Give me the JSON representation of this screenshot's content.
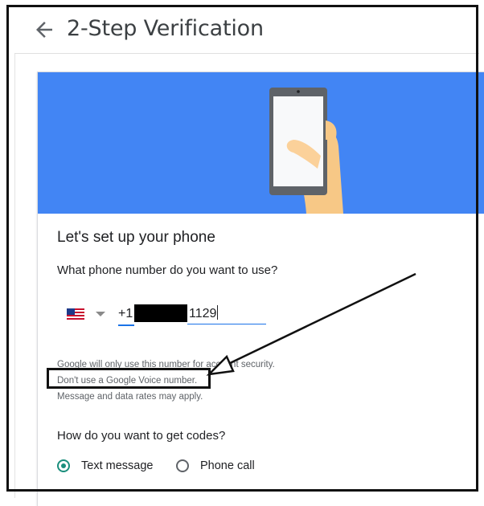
{
  "header": {
    "title": "2-Step Verification"
  },
  "card": {
    "heading": "Let's set up your phone",
    "phone_question": "What phone number do you want to use?",
    "country_code": "+1",
    "phone_visible_digits": "1129",
    "notes": [
      "Google will only use this number for account security.",
      "Don't use a Google Voice number.",
      "Message and data rates may apply."
    ],
    "codes_question": "How do you want to get codes?",
    "options": [
      {
        "label": "Text message",
        "selected": true
      },
      {
        "label": "Phone call",
        "selected": false
      }
    ]
  },
  "colors": {
    "hero": "#4285f4",
    "accent": "#1a73e8",
    "radio_selected": "#1a8e7c"
  },
  "icons": {
    "back": "arrow-left-icon",
    "flag": "us-flag-icon"
  }
}
